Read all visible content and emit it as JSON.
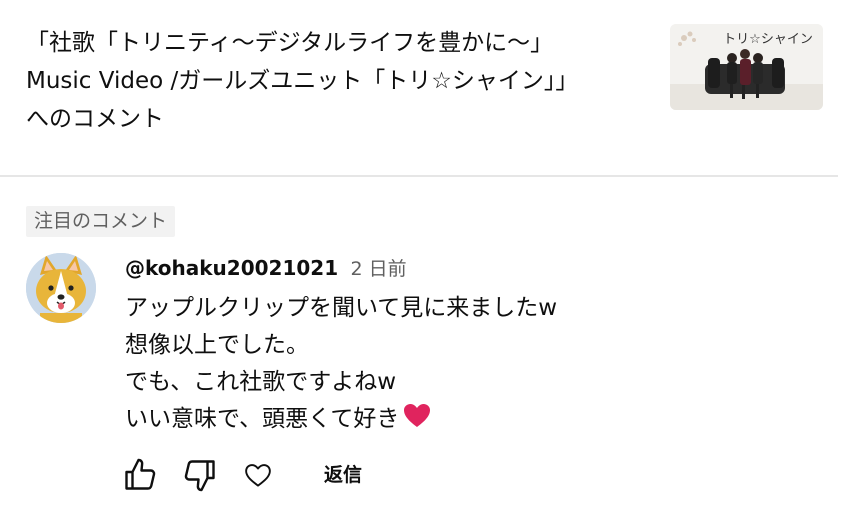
{
  "video": {
    "title_line1": "「社歌「トリニティ〜デジタルライフを豊かに〜」",
    "title_line2": "Music Video /ガールズユニット「トリ☆シャイン」」",
    "title_line3": "へのコメント",
    "thumbnail_caption": "トリ☆シャイン"
  },
  "section": {
    "badge": "注目のコメント"
  },
  "comment": {
    "author": "@kohaku20021021",
    "time": "2 日前",
    "lines": [
      "アップルクリップを聞いて見に来ましたw",
      "想像以上でした。",
      "でも、これ社歌ですよねw",
      "いい意味で、頭悪くて好き"
    ]
  },
  "actions": {
    "reply_label": "返信"
  },
  "icons": [
    "thumbs-up-icon",
    "thumbs-down-icon",
    "heart-outline-icon",
    "red-heart-emoji-icon"
  ],
  "colors": {
    "text": "#0f0f0f",
    "secondary": "#606060",
    "badge_bg": "#f2f2f2",
    "divider": "#e6e6e6",
    "heart": "#e0245e"
  }
}
